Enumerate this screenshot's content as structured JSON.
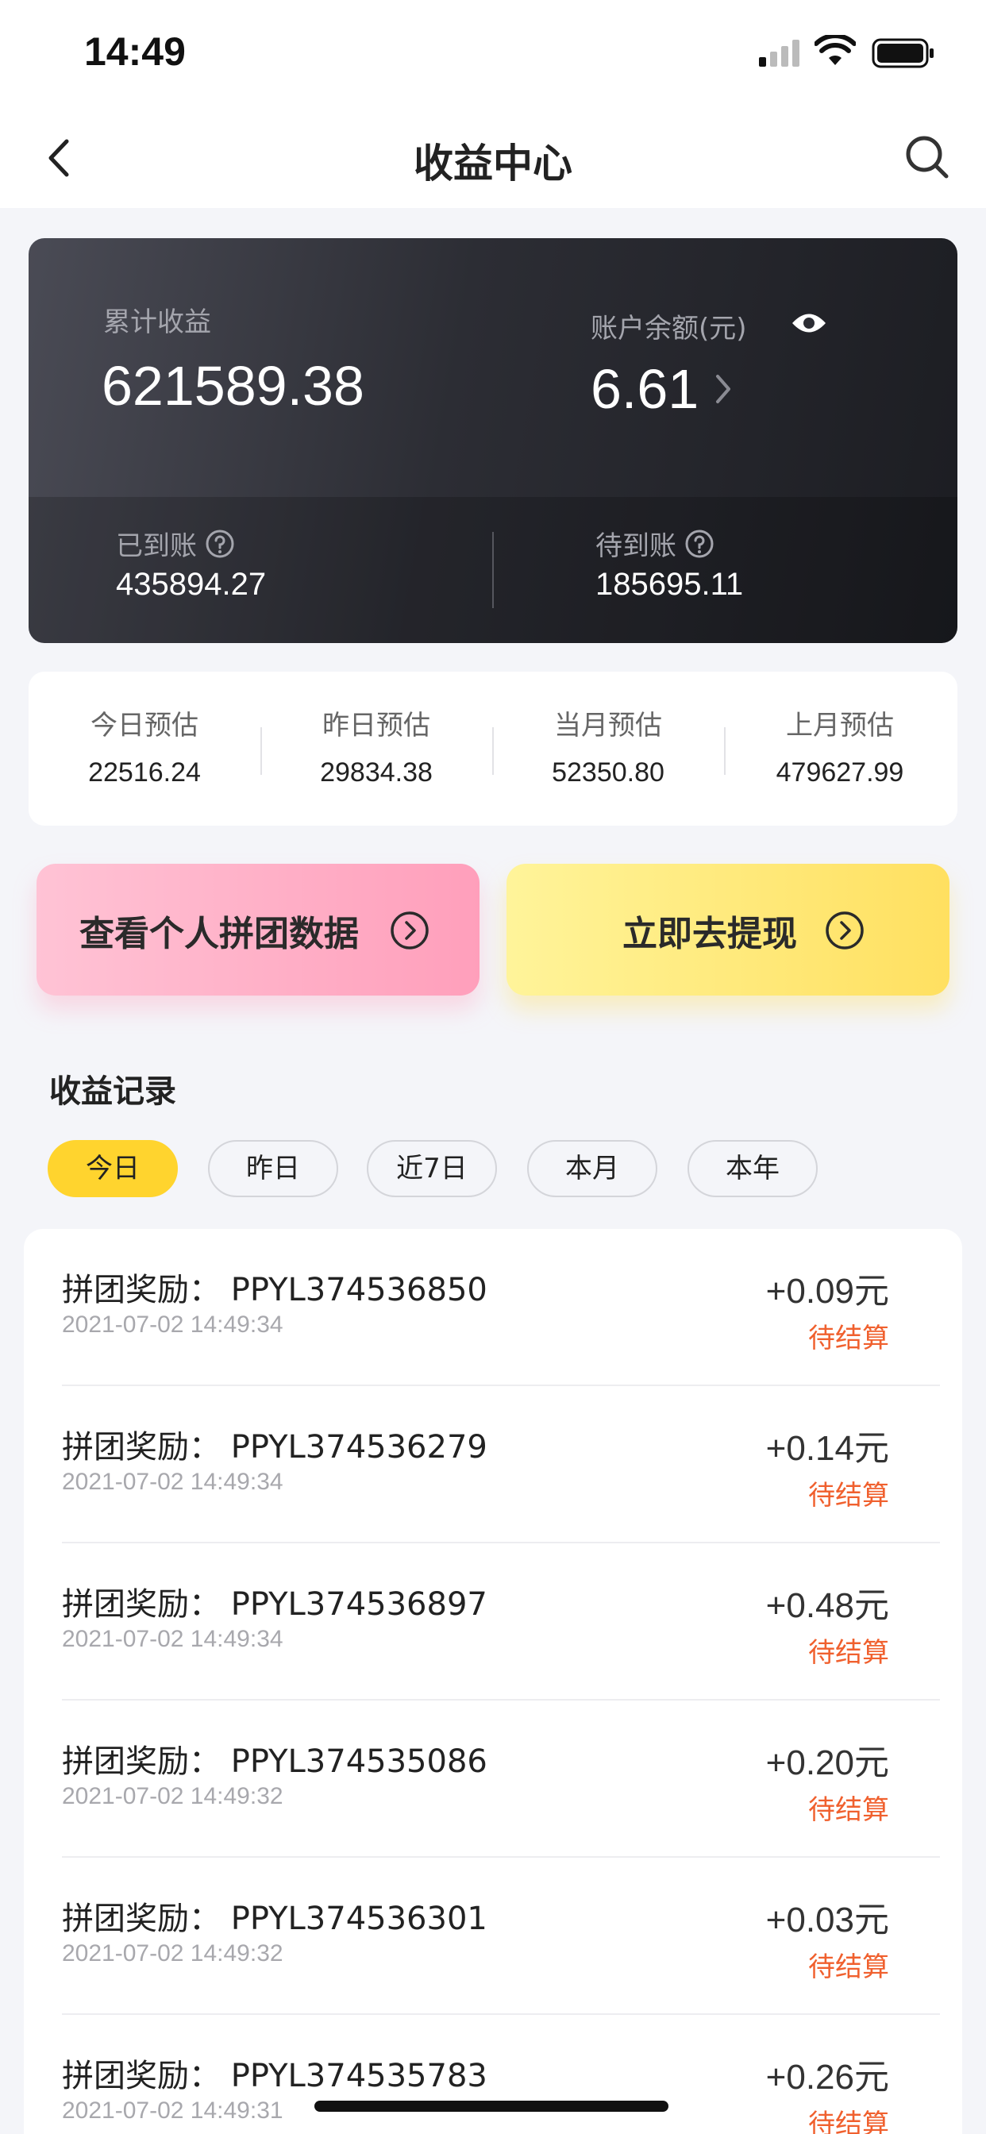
{
  "status_bar": {
    "time": "14:49"
  },
  "nav": {
    "title": "收益中心"
  },
  "summary": {
    "total_label": "累计收益",
    "total_value": "621589.38",
    "balance_label": "账户余额(元)",
    "balance_value": "6.61",
    "arrived_label": "已到账",
    "arrived_value": "435894.27",
    "pending_label": "待到账",
    "pending_value": "185695.11"
  },
  "estimates": [
    {
      "label": "今日预估",
      "value": "22516.24"
    },
    {
      "label": "昨日预估",
      "value": "29834.38"
    },
    {
      "label": "当月预估",
      "value": "52350.80"
    },
    {
      "label": "上月预估",
      "value": "479627.99"
    }
  ],
  "actions": {
    "group_data_label": "查看个人拼团数据",
    "withdraw_label": "立即去提现"
  },
  "records": {
    "title": "收益记录",
    "filters": [
      "今日",
      "昨日",
      "近7日",
      "本月",
      "本年"
    ],
    "active_filter": "今日",
    "items": [
      {
        "title": "拼团奖励： PPYL374536850",
        "time": "2021-07-02 14:49:34",
        "amount": "+0.09元",
        "status": "待结算"
      },
      {
        "title": "拼团奖励： PPYL374536279",
        "time": "2021-07-02 14:49:34",
        "amount": "+0.14元",
        "status": "待结算"
      },
      {
        "title": "拼团奖励： PPYL374536897",
        "time": "2021-07-02 14:49:34",
        "amount": "+0.48元",
        "status": "待结算"
      },
      {
        "title": "拼团奖励： PPYL374535086",
        "time": "2021-07-02 14:49:32",
        "amount": "+0.20元",
        "status": "待结算"
      },
      {
        "title": "拼团奖励： PPYL374536301",
        "time": "2021-07-02 14:49:32",
        "amount": "+0.03元",
        "status": "待结算"
      },
      {
        "title": "拼团奖励： PPYL374535783",
        "time": "2021-07-02 14:49:31",
        "amount": "+0.26元",
        "status": "待结算"
      }
    ]
  },
  "colors": {
    "accent_yellow": "#ffd42e",
    "status_orange": "#f0602e",
    "card_dark": "#2c2d34",
    "pink_button": "#ff9fbb"
  },
  "icons": {
    "back": "chevron-left-icon",
    "search": "search-icon",
    "eye": "eye-icon",
    "help": "question-circle-icon",
    "arrow": "chevron-right-circle-icon"
  }
}
